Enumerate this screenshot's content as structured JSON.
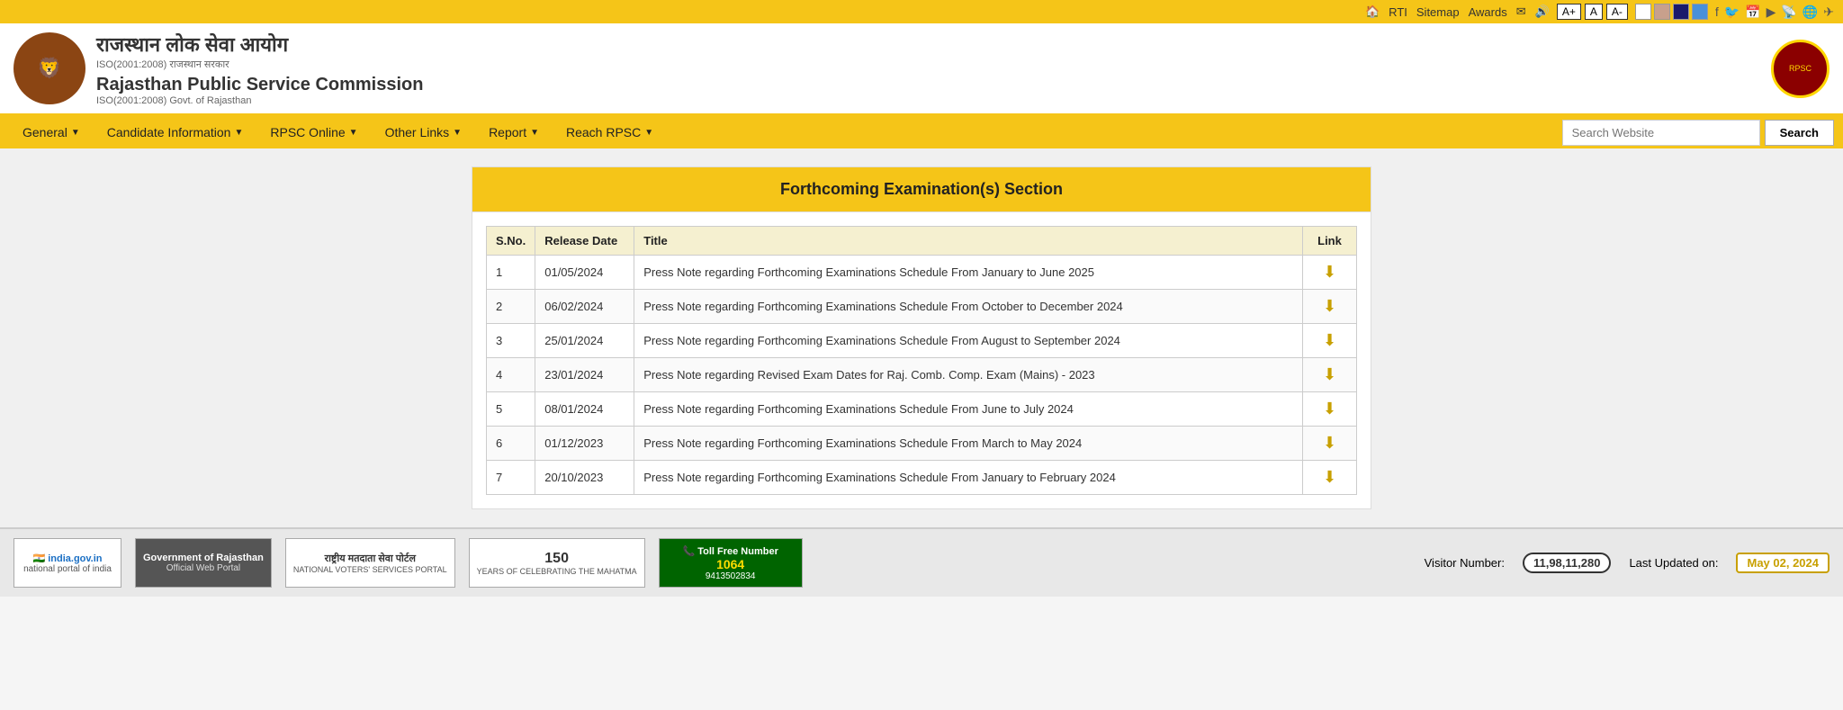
{
  "topbar": {
    "links": [
      "RTI",
      "Sitemap",
      "Awards"
    ],
    "font_labels": [
      "A+",
      "A",
      "A-"
    ],
    "colors": [
      "#ffffff",
      "#c8a08c",
      "#1a1a6c",
      "#4a90d9"
    ],
    "social": [
      "🏠",
      "f",
      "🐦",
      "📅",
      "▶",
      "📡",
      "🌐",
      "✈"
    ]
  },
  "header": {
    "hindi_title": "राजस्थान लोक सेवा आयोग",
    "iso_line1": "ISO(2001:2008) राजस्थान सरकार",
    "english_title": "Rajasthan Public Service Commission",
    "iso_line2": "ISO(2001:2008) Govt. of Rajasthan"
  },
  "nav": {
    "items": [
      {
        "label": "General",
        "has_arrow": true
      },
      {
        "label": "Candidate Information",
        "has_arrow": true
      },
      {
        "label": "RPSC Online",
        "has_arrow": true
      },
      {
        "label": "Other Links",
        "has_arrow": true
      },
      {
        "label": "Report",
        "has_arrow": true
      },
      {
        "label": "Reach RPSC",
        "has_arrow": true
      }
    ],
    "search_placeholder": "Search Website",
    "search_button": "Search"
  },
  "section": {
    "title": "Forthcoming Examination(s) Section",
    "table": {
      "headers": [
        "S.No.",
        "Release Date",
        "Title",
        "Link"
      ],
      "rows": [
        {
          "sno": "1",
          "date": "01/05/2024",
          "title": "Press Note regarding Forthcoming Examinations Schedule From January to June 2025"
        },
        {
          "sno": "2",
          "date": "06/02/2024",
          "title": "Press Note regarding Forthcoming Examinations Schedule From October to December 2024"
        },
        {
          "sno": "3",
          "date": "25/01/2024",
          "title": "Press Note regarding Forthcoming Examinations Schedule From August to September 2024"
        },
        {
          "sno": "4",
          "date": "23/01/2024",
          "title": "Press Note regarding Revised Exam Dates for Raj. Comb. Comp. Exam (Mains) - 2023"
        },
        {
          "sno": "5",
          "date": "08/01/2024",
          "title": "Press Note regarding Forthcoming Examinations Schedule From June to July 2024"
        },
        {
          "sno": "6",
          "date": "01/12/2023",
          "title": "Press Note regarding Forthcoming Examinations Schedule From March to May 2024"
        },
        {
          "sno": "7",
          "date": "20/10/2023",
          "title": "Press Note regarding Forthcoming Examinations Schedule From January to February 2024"
        }
      ]
    }
  },
  "footer": {
    "logos": [
      {
        "name": "india-gov",
        "line1": "india.gov.in",
        "line2": "national portal of india",
        "bg": "white"
      },
      {
        "name": "govt-rajasthan",
        "line1": "Government of Rajasthan",
        "line2": "Official Web Portal",
        "bg": "#555"
      },
      {
        "name": "voters-portal",
        "line1": "राष्ट्रीय मतदाता सेवा पोर्टल",
        "line2": "NATIONAL VOTERS' SERVICES PORTAL",
        "bg": "white"
      },
      {
        "name": "150-years",
        "line1": "150",
        "line2": "YEARS OF CELEBRATING THE MAHATMA",
        "bg": "white"
      },
      {
        "name": "anti-corruption",
        "line1": "Toll Free Number",
        "line2": "1064  9413502834",
        "bg": "#006400"
      }
    ],
    "visitor_label": "Visitor Number:",
    "visitor_number": "11,98,11,280",
    "updated_label": "Last Updated on:",
    "updated_date": "May 02, 2024"
  }
}
